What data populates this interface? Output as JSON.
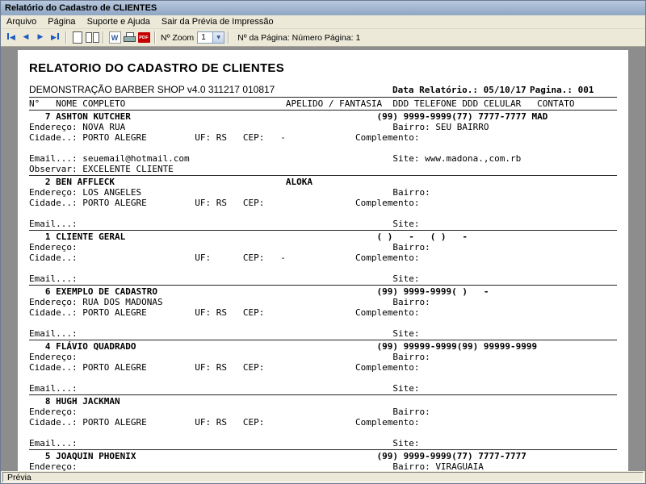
{
  "window": {
    "title": "Relatório do Cadastro de CLIENTES"
  },
  "menu": {
    "items": [
      "Arquivo",
      "Página",
      "Suporte e Ajuda",
      "Sair da Prévia de Impressão"
    ]
  },
  "toolbar": {
    "zoom_label": "Nº Zoom",
    "zoom_value": "1",
    "page_info": "Nº da Página: Número Página: 1",
    "icons": {
      "nav_prev": "◀",
      "nav_next": "▶",
      "combo_arrow": "▼",
      "word": "W",
      "pdf": "PDF"
    }
  },
  "report": {
    "title": "RELATORIO DO CADASTRO DE CLIENTES",
    "subtitle": "DEMONSTRAÇÃO BARBER SHOP v4.0 311217 010817",
    "date_label": "Data Relatório.: 05/10/17",
    "page_label": "Pagina.: 001",
    "columns_header": "N°   NOME COMPLETO                              APELIDO / FANTASIA  DDD TELEFONE DDD CELULAR   CONTATO",
    "records": [
      {
        "name_line": "   7 ASHTON KUTCHER                                              (99) 9999-9999(77) 7777-7777 MAD",
        "address_line": "Endereço: NOVA RUA                                                  Bairro: SEU BAIRRO",
        "city_line": "Cidade..: PORTO ALEGRE         UF: RS   CEP:   -             Complemento:",
        "email_line": "Email...: seuemail@hotmail.com                                      Site: www.madona.,com.rb",
        "notes_line": "Observar: EXCELENTE CLIENTE"
      },
      {
        "name_line": "   2 BEN AFFLECK                                ALOKA",
        "address_line": "Endereço: LOS ANGELES                                               Bairro:",
        "city_line": "Cidade..: PORTO ALEGRE         UF: RS   CEP:                 Complemento:",
        "email_line": "Email...:                                                           Site:"
      },
      {
        "name_line": "   1 CLIENTE GERAL                                               ( )   -   ( )   -",
        "address_line": "Endereço:                                                           Bairro:",
        "city_line": "Cidade..:                      UF:      CEP:   -             Complemento:",
        "email_line": "Email...:                                                           Site:"
      },
      {
        "name_line": "   6 EXEMPLO DE CADASTRO                                         (99) 9999-9999( )   -",
        "address_line": "Endereço: RUA DOS MADONAS                                           Bairro:",
        "city_line": "Cidade..: PORTO ALEGRE         UF: RS   CEP:                 Complemento:",
        "email_line": "Email...:                                                           Site:"
      },
      {
        "name_line": "   4 FLÁVIO QUADRADO                                             (99) 99999-9999(99) 99999-9999",
        "address_line": "Endereço:                                                           Bairro:",
        "city_line": "Cidade..: PORTO ALEGRE         UF: RS   CEP:                 Complemento:",
        "email_line": "Email...:                                                           Site:"
      },
      {
        "name_line": "   8 HUGH JACKMAN",
        "address_line": "Endereço:                                                           Bairro:",
        "city_line": "Cidade..: PORTO ALEGRE         UF: RS   CEP:                 Complemento:",
        "email_line": "Email...:                                                           Site:"
      },
      {
        "name_line": "   5 JOAQUIN PHOENIX                                             (99) 9999-9999(77) 7777-7777",
        "address_line": "Endereço:                                                           Bairro: VIRAGUAIA"
      }
    ]
  },
  "statusbar": {
    "text": "Prévia"
  }
}
